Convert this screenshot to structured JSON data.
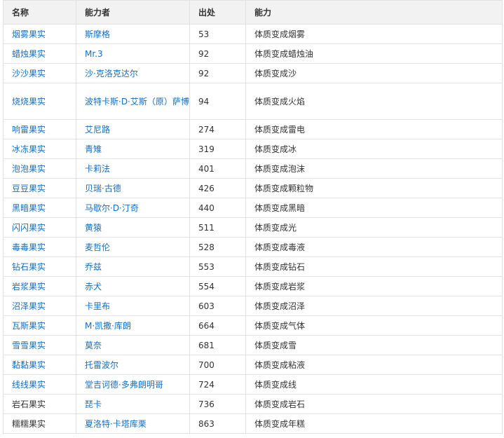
{
  "table": {
    "headers": [
      "名称",
      "能力者",
      "出处",
      "能力"
    ],
    "rows": [
      {
        "name": "烟雾果实",
        "user": "斯摩格",
        "source": "53",
        "ability": "体质变成烟雾",
        "name_link": true
      },
      {
        "name": "蜡烛果实",
        "user": "Mr.3",
        "source": "92",
        "ability": "体质变成蜡烛油",
        "name_link": true
      },
      {
        "name": "沙沙果实",
        "user": "沙·克洛克达尔",
        "source": "92",
        "ability": "体质变成沙",
        "name_link": true
      },
      {
        "name": "烧烧果实",
        "user": "波特卡斯·D·艾斯（原）萨博",
        "source": "94",
        "ability": "体质变成火焰",
        "name_link": true,
        "tall": true
      },
      {
        "name": "响雷果实",
        "user": "艾尼路",
        "source": "274",
        "ability": "体质变成雷电",
        "name_link": true
      },
      {
        "name": "冰冻果实",
        "user": "青雉",
        "source": "319",
        "ability": "体质变成冰",
        "name_link": true
      },
      {
        "name": "泡泡果实",
        "user": "卡莉法",
        "source": "401",
        "ability": "体质变成泡沫",
        "name_link": true
      },
      {
        "name": "豆豆果实",
        "user": "贝瑞·古德",
        "source": "426",
        "ability": "体质变成颗粒物",
        "name_link": true
      },
      {
        "name": "黑暗果实",
        "user": "马歇尔·D·汀奇",
        "source": "440",
        "ability": "体质变成黑暗",
        "name_link": true
      },
      {
        "name": "闪闪果实",
        "user": "黄猿",
        "source": "511",
        "ability": "体质变成光",
        "name_link": true
      },
      {
        "name": "毒毒果实",
        "user": "麦哲伦",
        "source": "528",
        "ability": "体质变成毒液",
        "name_link": true
      },
      {
        "name": "钻石果实",
        "user": "乔兹",
        "source": "553",
        "ability": "体质变成钻石",
        "name_link": true
      },
      {
        "name": "岩浆果实",
        "user": "赤犬",
        "source": "554",
        "ability": "体质变成岩浆",
        "name_link": true
      },
      {
        "name": "沼泽果实",
        "user": "卡里布",
        "source": "603",
        "ability": "体质变成沼泽",
        "name_link": true
      },
      {
        "name": "瓦斯果实",
        "user": "M·凯撒·库朗",
        "source": "664",
        "ability": "体质变成气体",
        "name_link": true
      },
      {
        "name": "雪雪果实",
        "user": "莫奈",
        "source": "681",
        "ability": "体质变成雪",
        "name_link": true
      },
      {
        "name": "黏黏果实",
        "user": "托雷波尔",
        "source": "700",
        "ability": "体质变成粘液",
        "name_link": true
      },
      {
        "name": "线线果实",
        "user": "堂吉诃德·多弗朗明哥",
        "source": "724",
        "ability": "体质变成线",
        "name_link": true
      },
      {
        "name": "岩石果实",
        "user": "琵卡",
        "source": "736",
        "ability": "体质变成岩石",
        "name_link": false
      },
      {
        "name": "糯糯果实",
        "user": "夏洛特·卡塔库栗",
        "source": "863",
        "ability": "体质变成年糕",
        "name_link": false
      }
    ]
  }
}
